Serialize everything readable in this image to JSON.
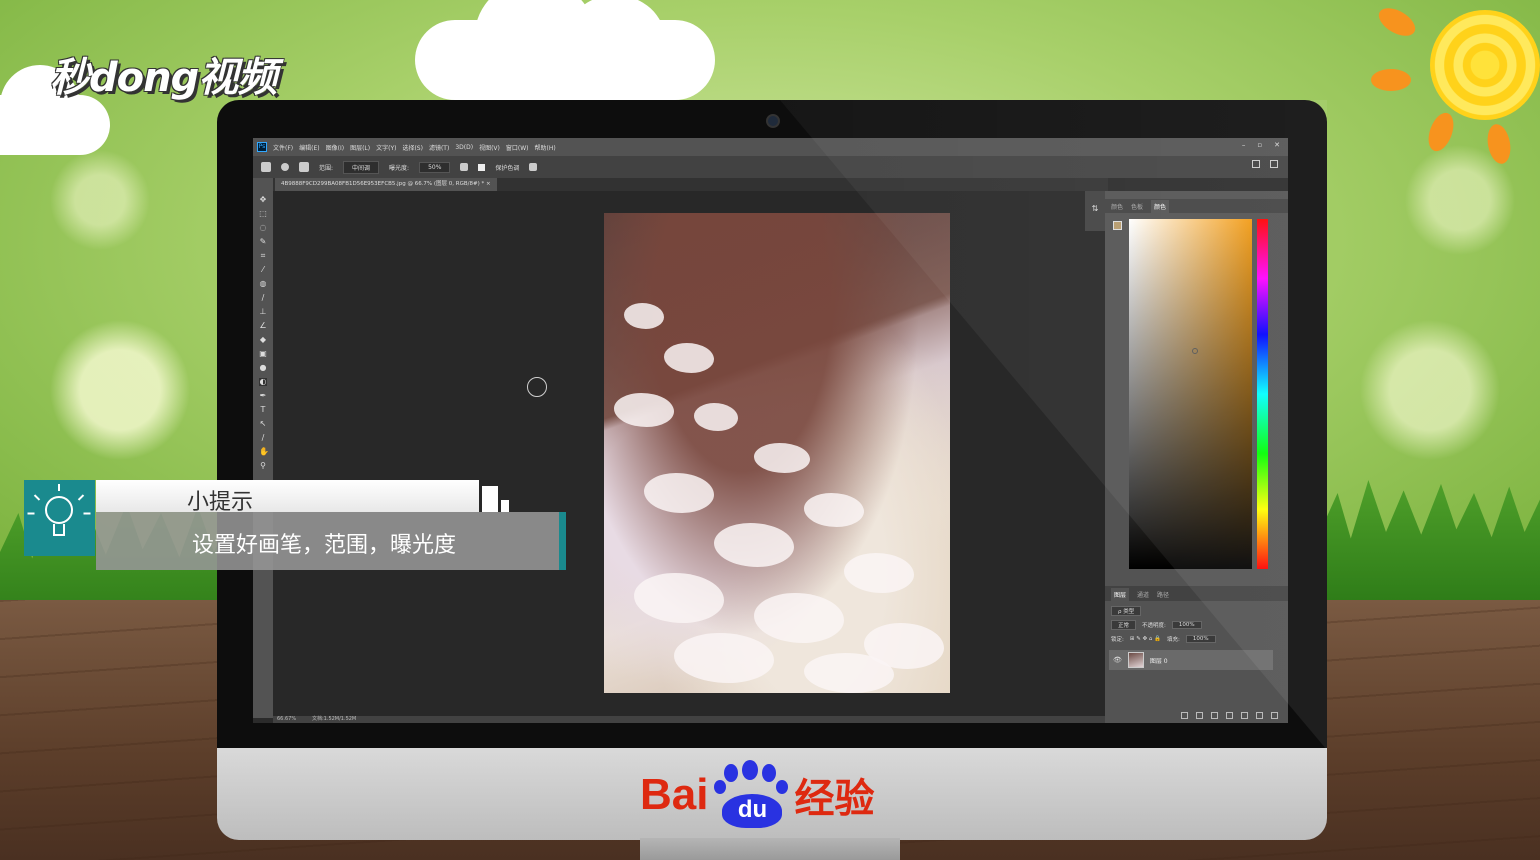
{
  "watermark": {
    "brand": "秒dong视频"
  },
  "footer": {
    "baidu_bai": "Bai",
    "baidu_du": "du",
    "baidu_suffix": "经验"
  },
  "photoshop": {
    "menu": [
      "文件(F)",
      "编辑(E)",
      "图像(I)",
      "图层(L)",
      "文字(Y)",
      "选择(S)",
      "滤镜(T)",
      "3D(D)",
      "视图(V)",
      "窗口(W)",
      "帮助(H)"
    ],
    "window_controls": [
      "–",
      "▫",
      "✕"
    ],
    "options": {
      "range_label": "范围:",
      "range_value": "中间调",
      "exposure_label": "曝光度:",
      "exposure_value": "50%",
      "protect_tones_label": "保护色调"
    },
    "document_tab": "4B9888F9CD299BA08FB1D56E953EFCB5.jpg @ 66.7% (图层 0, RGB/8#) * ×",
    "status": {
      "zoom": "66.67%",
      "doc_size": "文档:1.52M/1.52M"
    },
    "right_panel": {
      "tabs": [
        "颜色",
        "色板",
        "颜色"
      ],
      "active_tab_index": 2
    },
    "layers_panel": {
      "tabs": [
        "图层",
        "通道",
        "路径"
      ],
      "kind_label": "ρ 类型",
      "blend_mode": "正常",
      "opacity_label": "不透明度:",
      "opacity_value": "100%",
      "lock_label": "锁定:",
      "fill_label": "填充:",
      "fill_value": "100%",
      "layer_name": "图层 0"
    }
  },
  "tip": {
    "title": "小提示",
    "body": "设置好画笔，范围，曝光度"
  },
  "colors": {
    "tip_accent": "#1a8a8e",
    "baidu_red": "#de2910",
    "baidu_blue": "#2932e1",
    "ps_panel": "#535353"
  }
}
